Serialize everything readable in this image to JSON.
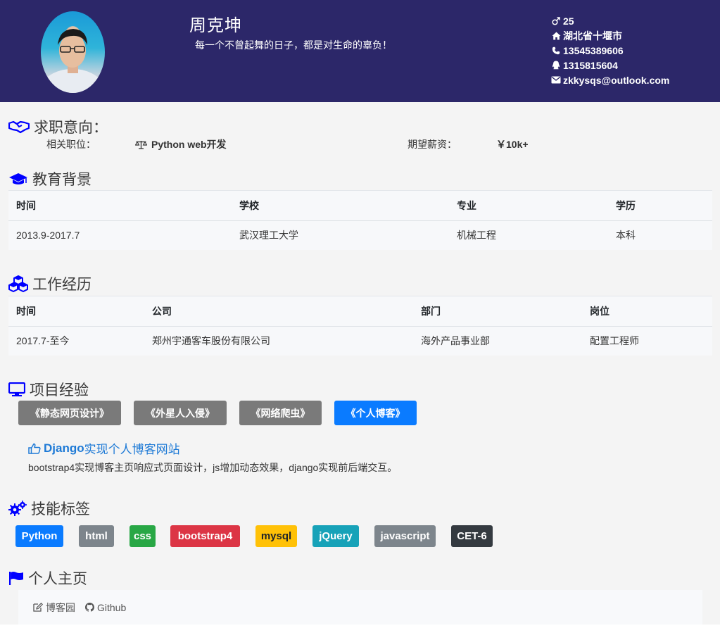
{
  "header": {
    "name": "周克坤",
    "motto": "每一个不曾起舞的日子，都是对生命的辜负！",
    "contact": {
      "age": "25",
      "location": "湖北省十堰市",
      "phone": "13545389606",
      "qq": "1315815604",
      "email": "zkkysqs@outlook.com"
    }
  },
  "intent": {
    "title": "求职意向：",
    "position_label": "相关职位：",
    "position_value": "Python web开发",
    "salary_label": "期望薪资：",
    "salary_value": "￥10k+"
  },
  "education": {
    "title": "教育背景",
    "headers": [
      "时间",
      "学校",
      "专业",
      "学历"
    ],
    "rows": [
      [
        "2013.9-2017.7",
        "武汉理工大学",
        "机械工程",
        "本科"
      ]
    ]
  },
  "work": {
    "title": "工作经历",
    "headers": [
      "时间",
      "公司",
      "部门",
      "岗位"
    ],
    "rows": [
      [
        "2017.7-至今",
        "郑州宇通客车股份有限公司",
        "海外产品事业部",
        "配置工程师"
      ]
    ]
  },
  "projects": {
    "title": "项目经验",
    "tabs": [
      "《静态网页设计》",
      "《外星人入侵》",
      "《网络爬虫》",
      "《个人博客》"
    ],
    "active_tab": "《个人博客》",
    "detail_title_prefix": "Django",
    "detail_title_rest": "实现个人博客网站",
    "detail_desc": "bootstrap4实现博客主页响应式页面设计，js增加动态效果，django实现前后端交互。"
  },
  "skills": {
    "title": "技能标签",
    "items": [
      {
        "label": "Python",
        "color": "#0a7bff"
      },
      {
        "label": "html",
        "color": "#7d858c"
      },
      {
        "label": "css",
        "color": "#28a745"
      },
      {
        "label": "bootstrap4",
        "color": "#dc3545"
      },
      {
        "label": "mysql",
        "color": "#ffc107"
      },
      {
        "label": "jQuery",
        "color": "#17a2b8"
      },
      {
        "label": "javascript",
        "color": "#7d858c"
      },
      {
        "label": "CET-6",
        "color": "#343a40"
      }
    ]
  },
  "homepage": {
    "title": "个人主页",
    "links": [
      "博客园",
      "Github"
    ]
  },
  "colors": {
    "header_bg": "#2c2769",
    "icon_blue": "#0000ff",
    "link_blue": "#1e7ad6"
  }
}
